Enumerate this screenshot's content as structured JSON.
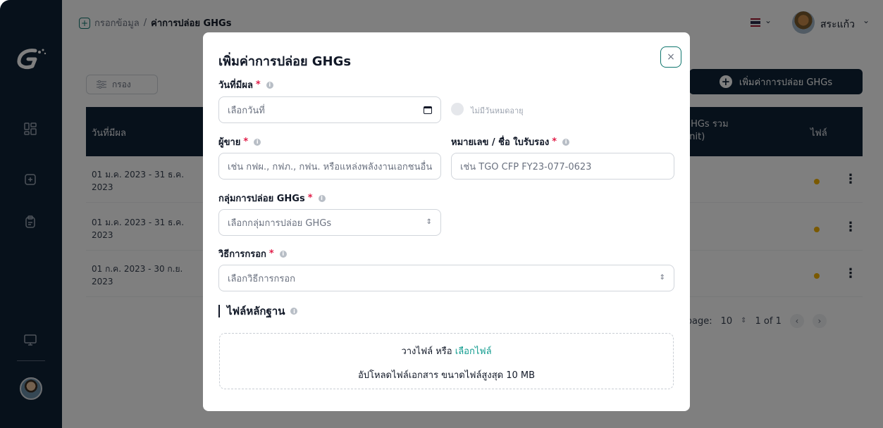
{
  "breadcrumb": {
    "parent": "กรอกข้อมูล",
    "separator": "/",
    "current": "ค่าการปล่อย GHGs"
  },
  "header": {
    "user_name": "สระแก้ว"
  },
  "toolbar": {
    "filter_label": "กรอง",
    "add_label": "เพิ่มค่าการปล่อย GHGs"
  },
  "table": {
    "columns": [
      "วันที่มีผล",
      "GHGs รวม\nunit)",
      "ไฟล์"
    ],
    "rows": [
      {
        "date": "01 ม.ค. 2023 - 31 ธ.ค. 2023"
      },
      {
        "date": "01 ม.ค. 2023 - 31 ธ.ค. 2023"
      },
      {
        "date": "01 ก.ค. 2023 - 30 ก.ย. 2023"
      }
    ],
    "pagination": {
      "per_page_label": "per page:",
      "per_page": "10",
      "range": "1 of 1"
    }
  },
  "modal": {
    "title": "เพิ่มค่าการปล่อย GHGs",
    "close_label": "×",
    "effective_date": {
      "label": "วันที่มีผล",
      "placeholder": "เลือกวันที่"
    },
    "no_expiry_label": "ไม่มีวันหมดอายุ",
    "seller": {
      "label": "ผู้ขาย",
      "placeholder": "เช่น กฟผ., กฟภ., กฟน. หรือแหล่งพลังงานเอกชนอื่นๆ"
    },
    "certificate": {
      "label": "หมายเลข / ชื่อ ใบรับรอง",
      "placeholder": "เช่น TGO CFP FY23-077-0623"
    },
    "ghg_group": {
      "label": "กลุ่มการปล่อย GHGs",
      "placeholder": "เลือกกลุ่มการปล่อย GHGs"
    },
    "method": {
      "label": "วิธีการกรอก",
      "placeholder": "เลือกวิธีการกรอก"
    },
    "evidence": {
      "title": "ไฟล์หลักฐาน",
      "drop_text": "วางไฟล์ หรือ",
      "choose_link": "เลือกไฟล์",
      "note": "อัปโหลดไฟล์เอกสาร ขนาดไฟล์สูงสุด 10 MB"
    },
    "required_mark": "*"
  },
  "colors": {
    "sidebar": "#0f2337",
    "accent": "#0f766e",
    "link": "#0f9b8e",
    "required": "#e11d48",
    "badge": "#f5b301"
  }
}
